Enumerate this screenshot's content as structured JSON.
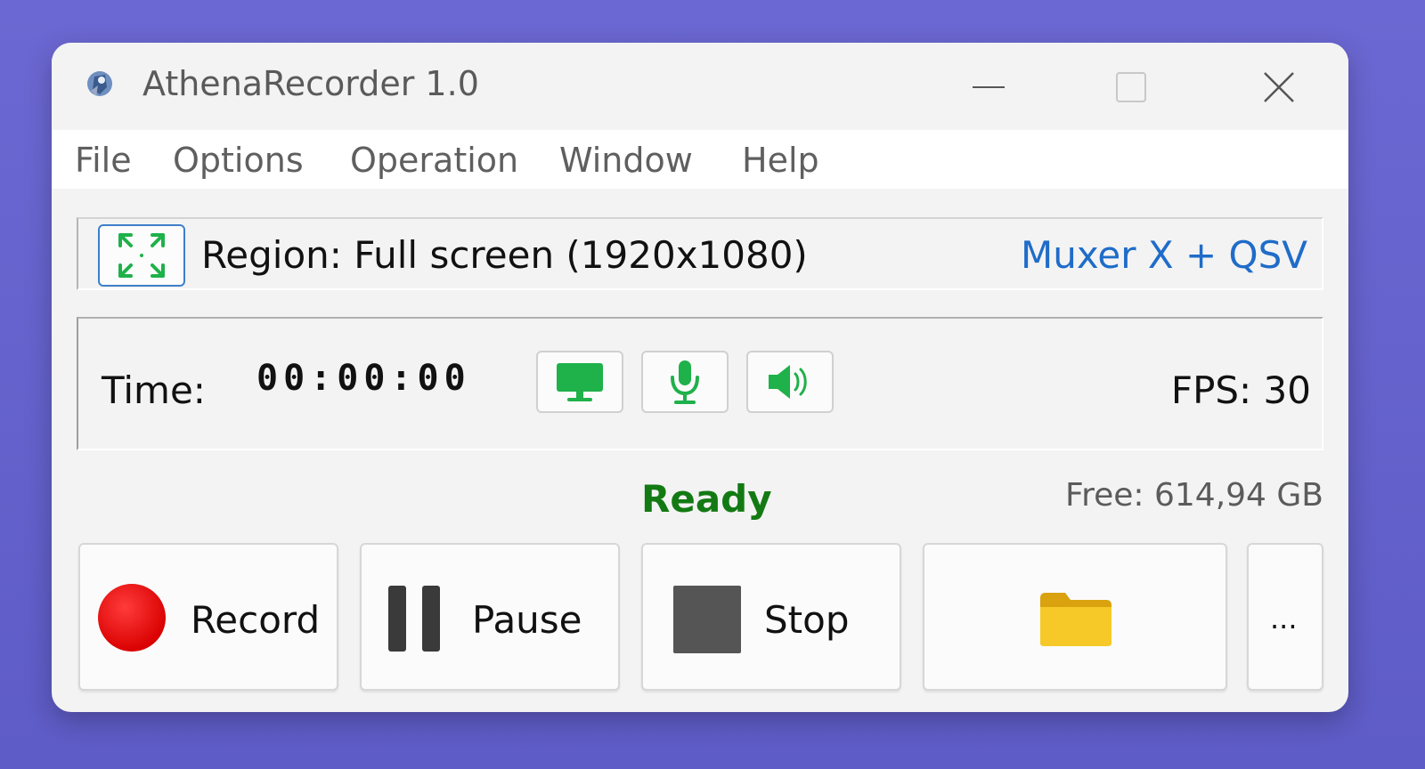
{
  "window": {
    "title": "AthenaRecorder 1.0",
    "controls": {
      "minimize": "minimize-icon",
      "maximize": "maximize-icon",
      "close": "close-icon"
    }
  },
  "menu": {
    "items": [
      "File",
      "Options",
      "Operation",
      "Window",
      "Help"
    ]
  },
  "region": {
    "label": "Region: Full screen (1920x1080)",
    "encoder": "Muxer X + QSV",
    "icon": "fullscreen-region-icon"
  },
  "timing": {
    "label": "Time:",
    "value": "00:00:00",
    "fps": "FPS: 30",
    "sources": [
      {
        "name": "screen-source",
        "icon": "monitor-icon"
      },
      {
        "name": "microphone-source",
        "icon": "microphone-icon"
      },
      {
        "name": "speaker-source",
        "icon": "speaker-icon"
      }
    ]
  },
  "status": {
    "text": "Ready",
    "free_space": "Free: 614,94 GB"
  },
  "actions": {
    "record": "Record",
    "pause": "Pause",
    "stop": "Stop",
    "more": "..."
  },
  "colors": {
    "accent_blue": "#1f6cc9",
    "status_green": "#137a13",
    "icon_green": "#1fb14a",
    "record_red": "#e81010",
    "folder_yellow": "#f3c318"
  }
}
